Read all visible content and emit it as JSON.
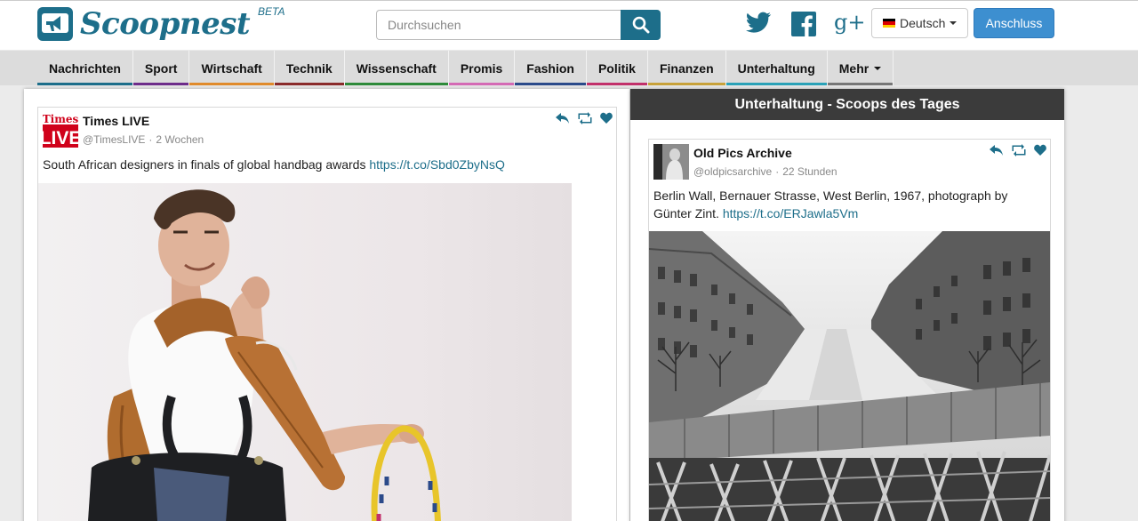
{
  "header": {
    "logo_text": "Scoopnest",
    "beta_label": "BETA",
    "search_placeholder": "Durchsuchen",
    "language_label": "Deutsch",
    "join_label": "Anschluss",
    "social_icons": [
      "twitter-icon",
      "facebook-icon",
      "google-plus-icon"
    ],
    "google_plus_label": "g+",
    "brand_color": "#1d6e8a",
    "join_color": "#3d8fd0"
  },
  "categories": [
    {
      "label": "Nachrichten",
      "color": "#1d6e8a"
    },
    {
      "label": "Sport",
      "color": "#6e2c8a"
    },
    {
      "label": "Wirtschaft",
      "color": "#e08a2b"
    },
    {
      "label": "Technik",
      "color": "#8a2b2b"
    },
    {
      "label": "Wissenschaft",
      "color": "#2e8a3a"
    },
    {
      "label": "Promis",
      "color": "#d46ab5"
    },
    {
      "label": "Fashion",
      "color": "#2b4a8a"
    },
    {
      "label": "Politik",
      "color": "#c2306b"
    },
    {
      "label": "Finanzen",
      "color": "#c9a23a"
    },
    {
      "label": "Unterhaltung",
      "color": "#2ba2b8"
    },
    {
      "label": "Mehr",
      "color": "#777777"
    }
  ],
  "left_feed": {
    "tweet": {
      "author": "Times LIVE",
      "handle": "@TimesLIVE",
      "time": "2 Wochen",
      "text": "South African designers in finals of global handbag awards ",
      "link": "https://t.co/Sbd0ZbyNsQ",
      "avatar_top": "Times",
      "avatar_bottom": "LIVE"
    }
  },
  "right_feed": {
    "heading": "Unterhaltung - Scoops des Tages",
    "tweet": {
      "author": "Old Pics Archive",
      "handle": "@oldpicsarchive",
      "time": "22 Stunden",
      "text": "Berlin Wall, Bernauer Strasse, West Berlin, 1967, photograph by Günter Zint. ",
      "link": "https://t.co/ERJawla5Vm"
    }
  }
}
